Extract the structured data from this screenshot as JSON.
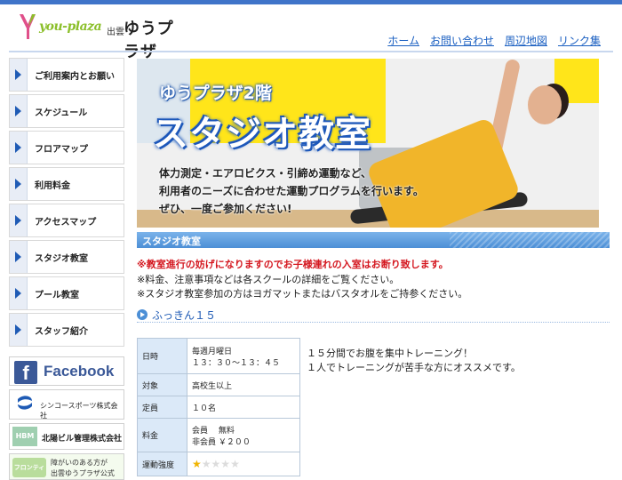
{
  "logo": {
    "brand": "you-plaza",
    "city": "出雲",
    "name": "ゆうプラザ"
  },
  "topnav": [
    "ホーム",
    "お問い合わせ",
    "周辺地図",
    "リンク集"
  ],
  "sidebar": {
    "items": [
      {
        "label": "ご利用案内とお願い"
      },
      {
        "label": "スケジュール"
      },
      {
        "label": "フロアマップ"
      },
      {
        "label": "利用料金"
      },
      {
        "label": "アクセスマップ"
      },
      {
        "label": "スタジオ教室"
      },
      {
        "label": "プール教室"
      },
      {
        "label": "スタッフ紹介"
      }
    ],
    "banners": {
      "facebook": "Facebook",
      "shinko": "シンコースポーツ株式会社",
      "hbm_logo": "HBM",
      "hbm": "北陽ビル管理株式会社",
      "frontier_logo": "フロンティア",
      "frontier_line1": "障がいのある方が",
      "frontier_line2": "出雲ゆうプラザ公式"
    }
  },
  "hero": {
    "subtitle": "ゆうプラザ2階",
    "title": "スタジオ教室",
    "lines": [
      "体力測定・エアロビクス・引締め運動など、",
      "利用者のニーズに合わせた運動プログラムを行います。",
      "ぜひ、一度ご参加ください!"
    ]
  },
  "section": {
    "title": "スタジオ教室"
  },
  "notices": [
    {
      "text": "※教室進行の妨げになりますのでお子様連れの入室はお断り致します。",
      "red": true
    },
    {
      "text": "※料金、注意事項などは各スクールの詳細をご覧ください。",
      "red": false
    },
    {
      "text": "※スタジオ教室参加の方はヨガマットまたはバスタオルをご持参ください。",
      "red": false
    }
  ],
  "class": {
    "name": "ふっきん１５",
    "rows": [
      {
        "label": "日時",
        "value1": "毎週月曜日",
        "value2": "１３：３０〜１３：４５"
      },
      {
        "label": "対象",
        "value1": "高校生以上"
      },
      {
        "label": "定員",
        "value1": "１０名"
      },
      {
        "label": "料金",
        "value1": "会員　 無料",
        "value2": "非会員 ￥２００"
      },
      {
        "label": "運動強度"
      }
    ],
    "intensity": 1,
    "intensity_max": 5,
    "description": [
      "１５分間でお腹を集中トレーニング！",
      "１人でトレーニングが苦手な方にオススメです。"
    ]
  },
  "colors": {
    "accent": "#3f74c9",
    "link": "#1a5fc1",
    "warning": "#d4171f",
    "star": "#f0b400"
  }
}
